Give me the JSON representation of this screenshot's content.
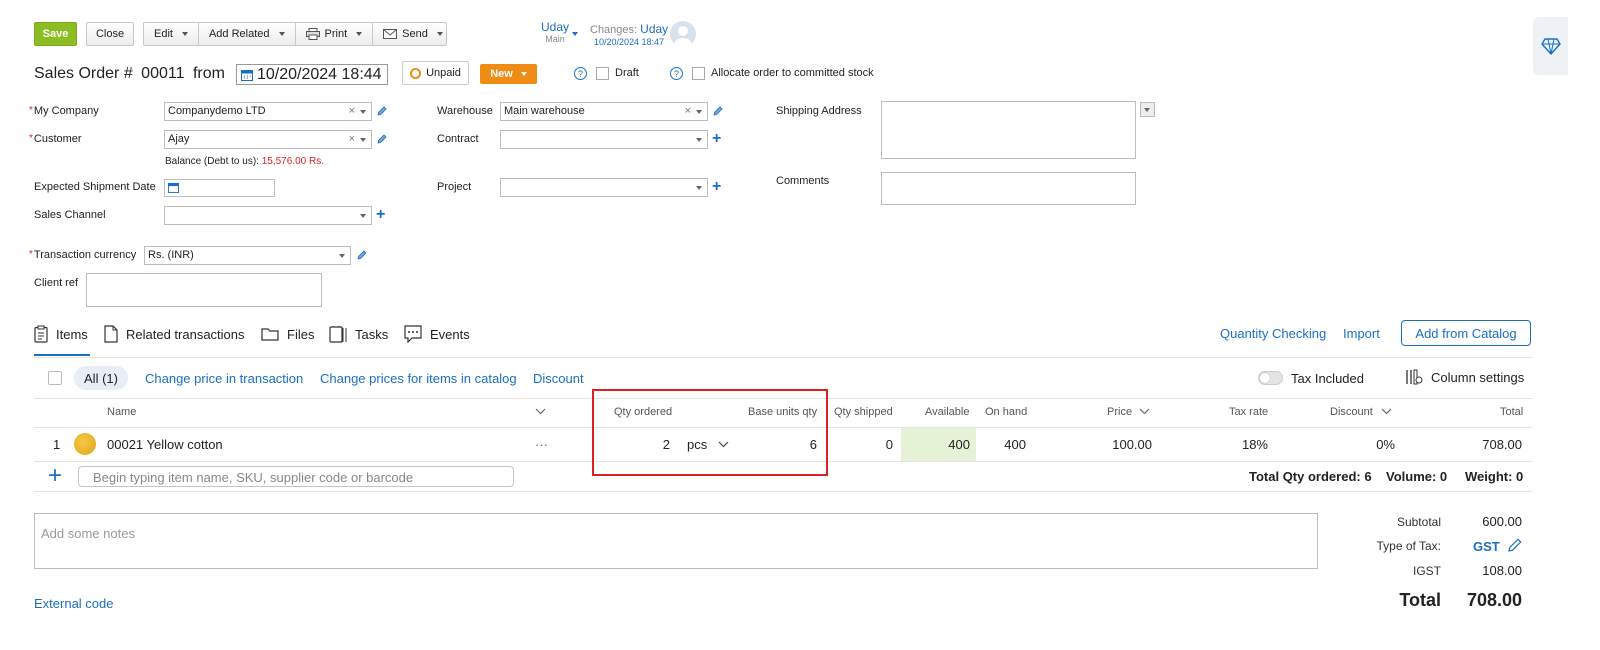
{
  "toolbar": {
    "save": "Save",
    "close": "Close",
    "edit": "Edit",
    "add_related": "Add Related",
    "print": "Print",
    "send": "Send"
  },
  "owner": {
    "name": "Uday",
    "sub": "Main"
  },
  "changes": {
    "label": "Changes:",
    "user": "Uday",
    "time": "10/20/2024 18:47"
  },
  "header": {
    "title": "Sales Order #",
    "number": "00011",
    "from": "from",
    "date": "10/20/2024 18:44",
    "status": "Unpaid",
    "stage": "New",
    "draft_label": "Draft",
    "allocate_label": "Allocate order to committed stock",
    "help": "?"
  },
  "form": {
    "my_company_label": "My Company",
    "my_company_value": "Companydemo LTD",
    "customer_label": "Customer",
    "customer_value": "Ajay",
    "balance_label": "Balance (Debt to us):",
    "balance_value": "15,576.00 Rs.",
    "expected_shipment_label": "Expected Shipment Date",
    "sales_channel_label": "Sales Channel",
    "currency_label": "Transaction currency",
    "currency_value": "Rs. (INR)",
    "client_ref_label": "Client ref",
    "warehouse_label": "Warehouse",
    "warehouse_value": "Main warehouse",
    "contract_label": "Contract",
    "project_label": "Project",
    "shipping_label": "Shipping Address",
    "comments_label": "Comments",
    "clear": "×"
  },
  "tabs": [
    {
      "label": "Items"
    },
    {
      "label": "Related transactions"
    },
    {
      "label": "Files"
    },
    {
      "label": "Tasks"
    },
    {
      "label": "Events"
    }
  ],
  "tab_actions": {
    "qty_checking": "Quantity Checking",
    "import": "Import",
    "add_catalog": "Add from Catalog"
  },
  "filters": {
    "all": "All (1)",
    "change_price_tx": "Change price in transaction",
    "change_price_catalog": "Change prices for items in catalog",
    "discount": "Discount",
    "tax_included": "Tax Included",
    "column_settings": "Column settings"
  },
  "table": {
    "headers": {
      "name": "Name",
      "qty_ordered": "Qty ordered",
      "base_units": "Base units qty",
      "qty_shipped": "Qty shipped",
      "available": "Available",
      "on_hand": "On hand",
      "price": "Price",
      "tax_rate": "Tax rate",
      "discount": "Discount",
      "total": "Total"
    },
    "rows": [
      {
        "num": "1",
        "name": "00021 Yellow cotton",
        "more": "···",
        "qty": "2",
        "unit": "pcs",
        "base_qty": "6",
        "shipped": "0",
        "available": "400",
        "on_hand": "400",
        "price": "100.00",
        "tax_rate": "18%",
        "discount": "0%",
        "total": "708.00"
      }
    ],
    "add_placeholder": "Begin typing item name, SKU, supplier code or barcode",
    "summary": {
      "total_qty": "Total Qty ordered: 6",
      "volume": "Volume: 0",
      "weight": "Weight: 0"
    }
  },
  "notes_placeholder": "Add some notes",
  "external_code": "External code",
  "totals": {
    "subtotal_label": "Subtotal",
    "subtotal_value": "600.00",
    "tax_type_label": "Type of Tax:",
    "tax_type_value": "GST",
    "igst_label": "IGST",
    "igst_value": "108.00",
    "total_label": "Total",
    "total_value": "708.00"
  },
  "colors": {
    "save": "#8cbd22",
    "stage": "#ee8c16",
    "link": "#1a6fc4",
    "highlight": "#e6f2d6",
    "annotation": "#e02020"
  }
}
